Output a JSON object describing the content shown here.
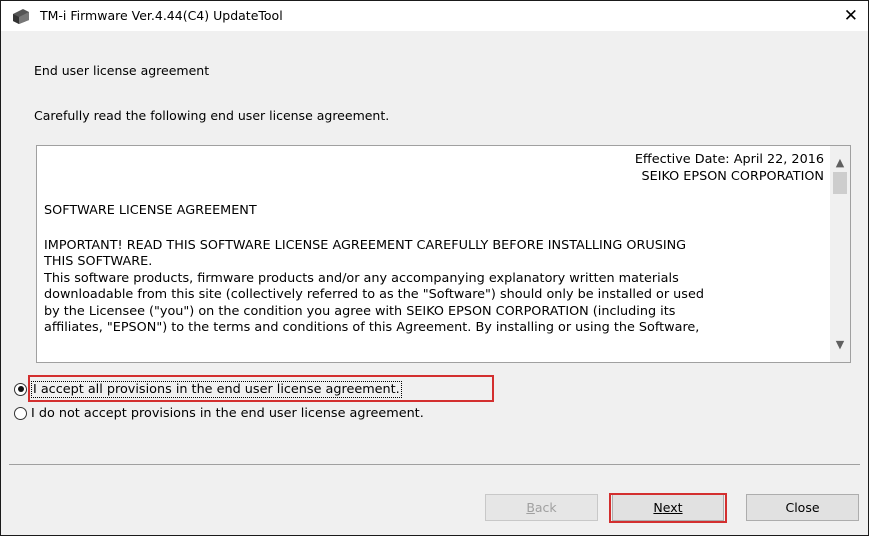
{
  "window": {
    "title": "TM-i Firmware Ver.4.44(C4) UpdateTool",
    "close_glyph": "✕"
  },
  "heading": "End user license agreement",
  "subheading": "Carefully read the following end user license agreement.",
  "eula": {
    "effective_date": "Effective Date: April 22, 2016",
    "company": "SEIKO EPSON CORPORATION",
    "title": "SOFTWARE LICENSE AGREEMENT",
    "important_1": "IMPORTANT! READ THIS SOFTWARE LICENSE AGREEMENT CAREFULLY BEFORE INSTALLING ORUSING",
    "important_2": "THIS SOFTWARE.",
    "body_1": "This software products, firmware products and/or any accompanying explanatory written materials",
    "body_2": "downloadable from this site (collectively referred to as the \"Software\") should only be installed or used",
    "body_3": "by the Licensee (\"you\") on the condition you agree with SEIKO EPSON CORPORATION (including its",
    "body_4": "affiliates, \"EPSON\") to the terms and conditions of this Agreement.  By installing or using the Software,"
  },
  "options": {
    "accept": "I accept all provisions in the end user license agreement.",
    "decline": "I do not accept provisions in the end user license agreement.",
    "selected": "accept"
  },
  "buttons": {
    "back_mnemonic": "B",
    "back_rest": "ack",
    "next_mnemonic": "N",
    "next_rest": "ext",
    "close": "Close"
  },
  "colors": {
    "highlight": "#d32f2f",
    "window_bg": "#f0f0f0"
  }
}
